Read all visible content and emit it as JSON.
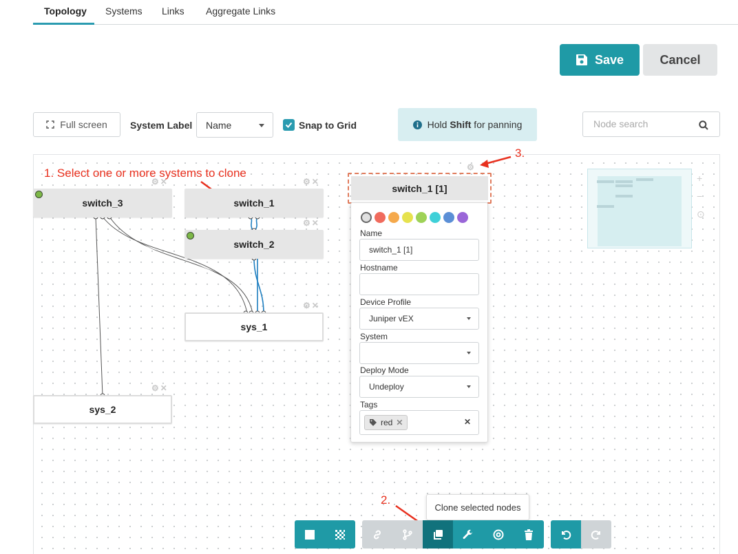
{
  "tabs": [
    {
      "label": "Topology",
      "active": true
    },
    {
      "label": "Systems",
      "active": false
    },
    {
      "label": "Links",
      "active": false
    },
    {
      "label": "Aggregate Links",
      "active": false
    }
  ],
  "actions": {
    "save_label": "Save",
    "cancel_label": "Cancel"
  },
  "toolbar": {
    "fullscreen_label": "Full screen",
    "system_label_title": "System Label",
    "system_label_value": "Name",
    "snap_label": "Snap to Grid",
    "snap_checked": true,
    "hint_prefix": "Hold ",
    "hint_key": "Shift",
    "hint_suffix": " for panning",
    "search_placeholder": "Node search"
  },
  "canvas": {
    "nodes": [
      {
        "label": "switch_3",
        "status": "green"
      },
      {
        "label": "switch_1",
        "status": "none"
      },
      {
        "label": "switch_2",
        "status": "green"
      },
      {
        "label": "sys_1",
        "status": "none"
      },
      {
        "label": "sys_2",
        "status": "none"
      }
    ],
    "annotations": {
      "step1": "1. Select one or more systems to clone",
      "step2": "2.",
      "step3": "3."
    },
    "node_controls": "⚙✕"
  },
  "editor": {
    "node_label": "switch_1 [1]",
    "colors": [
      "#e0e0e0",
      "#f06b5d",
      "#f5a94c",
      "#e6e24e",
      "#9ed257",
      "#3fd0d8",
      "#5b8fd6",
      "#9a66d8"
    ],
    "fields": {
      "name_label": "Name",
      "name_value": "switch_1 [1]",
      "hostname_label": "Hostname",
      "hostname_value": "",
      "profile_label": "Device Profile",
      "profile_value": "Juniper vEX",
      "system_label": "System",
      "system_value": "",
      "deploy_label": "Deploy Mode",
      "deploy_value": "Undeploy",
      "tags_label": "Tags",
      "tag_value": "red"
    }
  },
  "minimap": {
    "zoom_in": "+",
    "zoom_out": "−",
    "zoom_reset": "⊙"
  },
  "bottom_toolbar": {
    "tooltip": "Clone selected nodes",
    "groups": [
      [
        "select-all-icon",
        "pattern-icon"
      ],
      [
        "link-icon",
        "branch-icon",
        "clone-icon",
        "wrench-icon",
        "target-icon",
        "trash-icon"
      ],
      [
        "undo-icon",
        "redo-icon"
      ]
    ]
  },
  "colors": {
    "accent": "#1f9aa6",
    "accent_dark": "#11727c",
    "annotation": "#e8301e",
    "status_green": "#7db847"
  }
}
